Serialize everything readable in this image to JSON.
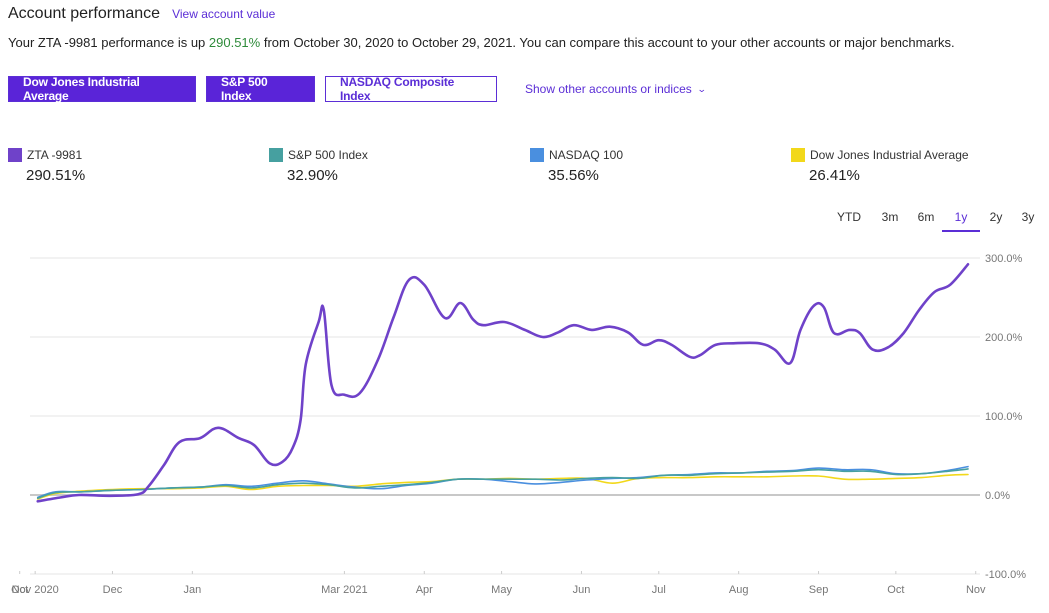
{
  "header": {
    "title": "Account performance",
    "view_link": "View account value"
  },
  "summary": {
    "prefix": "Your ZTA -9981 performance is up ",
    "value": "290.51%",
    "suffix": " from October 30, 2020 to October 29, 2021. You can compare this account to your other accounts or major benchmarks."
  },
  "benchmark_buttons": [
    {
      "label": "Dow Jones Industrial Average",
      "selected": true
    },
    {
      "label": "S&P 500 Index",
      "selected": true
    },
    {
      "label": "NASDAQ Composite Index",
      "selected": false
    }
  ],
  "show_other": {
    "label": "Show other accounts or indices",
    "icon": "chevron-down-icon"
  },
  "legend": [
    {
      "name": "ZTA -9981",
      "value": "290.51%",
      "color": "#6f42c9"
    },
    {
      "name": "S&P 500 Index",
      "value": "32.90%",
      "color": "#46a0a0"
    },
    {
      "name": "NASDAQ 100",
      "value": "35.56%",
      "color": "#4a8fdf"
    },
    {
      "name": "Dow Jones Industrial Average",
      "value": "26.41%",
      "color": "#f2d81a"
    }
  ],
  "time_ranges": [
    {
      "label": "YTD",
      "active": false
    },
    {
      "label": "3m",
      "active": false
    },
    {
      "label": "6m",
      "active": false
    },
    {
      "label": "1y",
      "active": true
    },
    {
      "label": "2y",
      "active": false
    },
    {
      "label": "3y",
      "active": false
    }
  ],
  "chart_data": {
    "type": "line",
    "title": "",
    "xlabel": "",
    "ylabel": "",
    "x_unit": "days since Oct 30, 2020",
    "xlim": [
      0,
      364
    ],
    "ylim": [
      -100,
      300
    ],
    "y_ticks": [
      300,
      200,
      100,
      0,
      -100
    ],
    "y_tick_labels": [
      "300.0%",
      "200.0%",
      "100.0%",
      "0.0%",
      "-100.0%"
    ],
    "x_ticks": [
      {
        "day": -4,
        "label": "Oct"
      },
      {
        "day": 2,
        "label": "Nov 2020"
      },
      {
        "day": 32,
        "label": "Dec"
      },
      {
        "day": 63,
        "label": "Jan"
      },
      {
        "day": 122,
        "label": "Mar 2021"
      },
      {
        "day": 153,
        "label": "Apr"
      },
      {
        "day": 183,
        "label": "May"
      },
      {
        "day": 214,
        "label": "Jun"
      },
      {
        "day": 244,
        "label": "Jul"
      },
      {
        "day": 275,
        "label": "Aug"
      },
      {
        "day": 306,
        "label": "Sep"
      },
      {
        "day": 336,
        "label": "Oct"
      },
      {
        "day": 367,
        "label": "Nov"
      }
    ],
    "grid": true,
    "legend_position": "top",
    "series": [
      {
        "name": "ZTA -9981",
        "color": "#6f42c9",
        "points": [
          [
            3,
            -8
          ],
          [
            12,
            -3
          ],
          [
            19,
            0
          ],
          [
            31,
            -1
          ],
          [
            42,
            1
          ],
          [
            46,
            11
          ],
          [
            52,
            38
          ],
          [
            58,
            67
          ],
          [
            66,
            72
          ],
          [
            73,
            85
          ],
          [
            81,
            72
          ],
          [
            87,
            63
          ],
          [
            93,
            40
          ],
          [
            98,
            42
          ],
          [
            102,
            60
          ],
          [
            105,
            95
          ],
          [
            107,
            165
          ],
          [
            112,
            219
          ],
          [
            114,
            234
          ],
          [
            117,
            139
          ],
          [
            122,
            127
          ],
          [
            128,
            129
          ],
          [
            135,
            171
          ],
          [
            141,
            224
          ],
          [
            147,
            272
          ],
          [
            153,
            266
          ],
          [
            161,
            224
          ],
          [
            167,
            243
          ],
          [
            172,
            222
          ],
          [
            176,
            215
          ],
          [
            184,
            219
          ],
          [
            192,
            209
          ],
          [
            199,
            200
          ],
          [
            205,
            206
          ],
          [
            211,
            215
          ],
          [
            218,
            209
          ],
          [
            225,
            213
          ],
          [
            232,
            206
          ],
          [
            238,
            190
          ],
          [
            244,
            196
          ],
          [
            249,
            190
          ],
          [
            256,
            175
          ],
          [
            260,
            177
          ],
          [
            266,
            190
          ],
          [
            273,
            192
          ],
          [
            283,
            192
          ],
          [
            289,
            184
          ],
          [
            295,
            167
          ],
          [
            299,
            209
          ],
          [
            304,
            239
          ],
          [
            308,
            238
          ],
          [
            312,
            205
          ],
          [
            318,
            209
          ],
          [
            322,
            205
          ],
          [
            327,
            184
          ],
          [
            333,
            187
          ],
          [
            339,
            205
          ],
          [
            345,
            234
          ],
          [
            351,
            257
          ],
          [
            357,
            266
          ],
          [
            364,
            292
          ]
        ]
      },
      {
        "name": "S&P 500 Index",
        "color": "#46a0a0",
        "points": [
          [
            3,
            -4
          ],
          [
            10,
            3
          ],
          [
            20,
            4
          ],
          [
            32,
            6
          ],
          [
            44,
            7
          ],
          [
            55,
            9
          ],
          [
            66,
            10
          ],
          [
            76,
            12
          ],
          [
            86,
            9
          ],
          [
            96,
            13
          ],
          [
            106,
            15
          ],
          [
            116,
            13
          ],
          [
            126,
            9
          ],
          [
            136,
            11
          ],
          [
            146,
            13
          ],
          [
            156,
            16
          ],
          [
            166,
            20
          ],
          [
            176,
            20
          ],
          [
            186,
            20
          ],
          [
            196,
            20
          ],
          [
            206,
            19
          ],
          [
            216,
            21
          ],
          [
            226,
            22
          ],
          [
            236,
            21
          ],
          [
            246,
            25
          ],
          [
            256,
            25
          ],
          [
            266,
            27
          ],
          [
            276,
            28
          ],
          [
            286,
            29
          ],
          [
            296,
            30
          ],
          [
            306,
            32
          ],
          [
            316,
            30
          ],
          [
            326,
            30
          ],
          [
            336,
            26
          ],
          [
            346,
            27
          ],
          [
            356,
            30
          ],
          [
            364,
            33
          ]
        ]
      },
      {
        "name": "NASDAQ 100",
        "color": "#4a8fdf",
        "points": [
          [
            3,
            -3
          ],
          [
            10,
            4
          ],
          [
            20,
            4
          ],
          [
            32,
            6
          ],
          [
            44,
            7
          ],
          [
            55,
            9
          ],
          [
            66,
            10
          ],
          [
            76,
            13
          ],
          [
            86,
            11
          ],
          [
            96,
            15
          ],
          [
            106,
            18
          ],
          [
            116,
            14
          ],
          [
            126,
            10
          ],
          [
            136,
            8
          ],
          [
            146,
            12
          ],
          [
            156,
            15
          ],
          [
            166,
            20
          ],
          [
            176,
            20
          ],
          [
            186,
            17
          ],
          [
            196,
            14
          ],
          [
            206,
            16
          ],
          [
            216,
            19
          ],
          [
            226,
            21
          ],
          [
            236,
            22
          ],
          [
            246,
            25
          ],
          [
            256,
            26
          ],
          [
            266,
            28
          ],
          [
            276,
            28
          ],
          [
            286,
            30
          ],
          [
            296,
            31
          ],
          [
            306,
            34
          ],
          [
            316,
            32
          ],
          [
            326,
            32
          ],
          [
            336,
            27
          ],
          [
            346,
            27
          ],
          [
            356,
            31
          ],
          [
            364,
            36
          ]
        ]
      },
      {
        "name": "Dow Jones Industrial Average",
        "color": "#f2d81a",
        "points": [
          [
            3,
            -5
          ],
          [
            10,
            2
          ],
          [
            20,
            5
          ],
          [
            32,
            7
          ],
          [
            44,
            8
          ],
          [
            55,
            8
          ],
          [
            66,
            9
          ],
          [
            76,
            11
          ],
          [
            86,
            7
          ],
          [
            96,
            11
          ],
          [
            106,
            12
          ],
          [
            116,
            12
          ],
          [
            126,
            11
          ],
          [
            136,
            14
          ],
          [
            146,
            16
          ],
          [
            156,
            17
          ],
          [
            166,
            20
          ],
          [
            176,
            20
          ],
          [
            186,
            21
          ],
          [
            196,
            20
          ],
          [
            206,
            21
          ],
          [
            216,
            21
          ],
          [
            226,
            15
          ],
          [
            236,
            21
          ],
          [
            246,
            22
          ],
          [
            256,
            22
          ],
          [
            266,
            23
          ],
          [
            276,
            23
          ],
          [
            286,
            23
          ],
          [
            296,
            24
          ],
          [
            306,
            24
          ],
          [
            316,
            20
          ],
          [
            326,
            20
          ],
          [
            336,
            21
          ],
          [
            346,
            22
          ],
          [
            356,
            25
          ],
          [
            364,
            26
          ]
        ]
      }
    ]
  }
}
